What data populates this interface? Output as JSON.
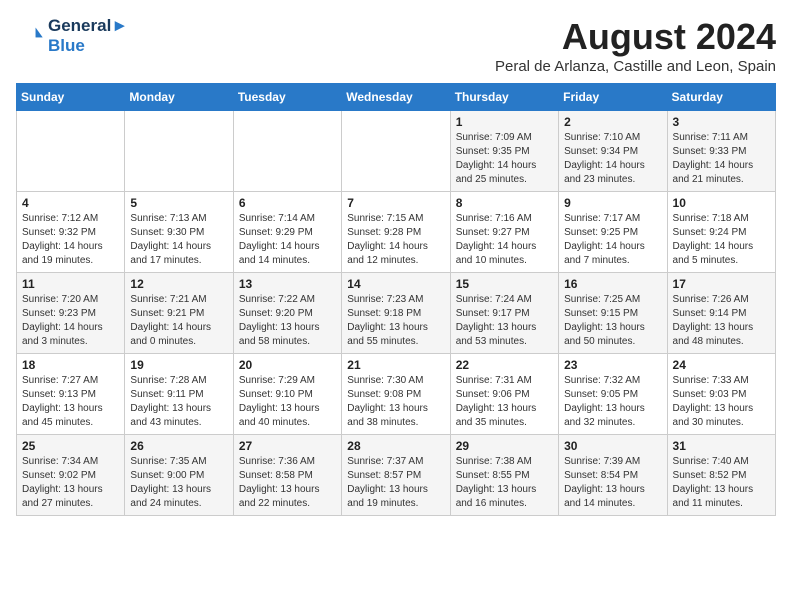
{
  "header": {
    "logo_line1": "General",
    "logo_line2": "Blue",
    "month_year": "August 2024",
    "location": "Peral de Arlanza, Castille and Leon, Spain"
  },
  "days_of_week": [
    "Sunday",
    "Monday",
    "Tuesday",
    "Wednesday",
    "Thursday",
    "Friday",
    "Saturday"
  ],
  "weeks": [
    [
      {
        "num": "",
        "info": ""
      },
      {
        "num": "",
        "info": ""
      },
      {
        "num": "",
        "info": ""
      },
      {
        "num": "",
        "info": ""
      },
      {
        "num": "1",
        "info": "Sunrise: 7:09 AM\nSunset: 9:35 PM\nDaylight: 14 hours\nand 25 minutes."
      },
      {
        "num": "2",
        "info": "Sunrise: 7:10 AM\nSunset: 9:34 PM\nDaylight: 14 hours\nand 23 minutes."
      },
      {
        "num": "3",
        "info": "Sunrise: 7:11 AM\nSunset: 9:33 PM\nDaylight: 14 hours\nand 21 minutes."
      }
    ],
    [
      {
        "num": "4",
        "info": "Sunrise: 7:12 AM\nSunset: 9:32 PM\nDaylight: 14 hours\nand 19 minutes."
      },
      {
        "num": "5",
        "info": "Sunrise: 7:13 AM\nSunset: 9:30 PM\nDaylight: 14 hours\nand 17 minutes."
      },
      {
        "num": "6",
        "info": "Sunrise: 7:14 AM\nSunset: 9:29 PM\nDaylight: 14 hours\nand 14 minutes."
      },
      {
        "num": "7",
        "info": "Sunrise: 7:15 AM\nSunset: 9:28 PM\nDaylight: 14 hours\nand 12 minutes."
      },
      {
        "num": "8",
        "info": "Sunrise: 7:16 AM\nSunset: 9:27 PM\nDaylight: 14 hours\nand 10 minutes."
      },
      {
        "num": "9",
        "info": "Sunrise: 7:17 AM\nSunset: 9:25 PM\nDaylight: 14 hours\nand 7 minutes."
      },
      {
        "num": "10",
        "info": "Sunrise: 7:18 AM\nSunset: 9:24 PM\nDaylight: 14 hours\nand 5 minutes."
      }
    ],
    [
      {
        "num": "11",
        "info": "Sunrise: 7:20 AM\nSunset: 9:23 PM\nDaylight: 14 hours\nand 3 minutes."
      },
      {
        "num": "12",
        "info": "Sunrise: 7:21 AM\nSunset: 9:21 PM\nDaylight: 14 hours\nand 0 minutes."
      },
      {
        "num": "13",
        "info": "Sunrise: 7:22 AM\nSunset: 9:20 PM\nDaylight: 13 hours\nand 58 minutes."
      },
      {
        "num": "14",
        "info": "Sunrise: 7:23 AM\nSunset: 9:18 PM\nDaylight: 13 hours\nand 55 minutes."
      },
      {
        "num": "15",
        "info": "Sunrise: 7:24 AM\nSunset: 9:17 PM\nDaylight: 13 hours\nand 53 minutes."
      },
      {
        "num": "16",
        "info": "Sunrise: 7:25 AM\nSunset: 9:15 PM\nDaylight: 13 hours\nand 50 minutes."
      },
      {
        "num": "17",
        "info": "Sunrise: 7:26 AM\nSunset: 9:14 PM\nDaylight: 13 hours\nand 48 minutes."
      }
    ],
    [
      {
        "num": "18",
        "info": "Sunrise: 7:27 AM\nSunset: 9:13 PM\nDaylight: 13 hours\nand 45 minutes."
      },
      {
        "num": "19",
        "info": "Sunrise: 7:28 AM\nSunset: 9:11 PM\nDaylight: 13 hours\nand 43 minutes."
      },
      {
        "num": "20",
        "info": "Sunrise: 7:29 AM\nSunset: 9:10 PM\nDaylight: 13 hours\nand 40 minutes."
      },
      {
        "num": "21",
        "info": "Sunrise: 7:30 AM\nSunset: 9:08 PM\nDaylight: 13 hours\nand 38 minutes."
      },
      {
        "num": "22",
        "info": "Sunrise: 7:31 AM\nSunset: 9:06 PM\nDaylight: 13 hours\nand 35 minutes."
      },
      {
        "num": "23",
        "info": "Sunrise: 7:32 AM\nSunset: 9:05 PM\nDaylight: 13 hours\nand 32 minutes."
      },
      {
        "num": "24",
        "info": "Sunrise: 7:33 AM\nSunset: 9:03 PM\nDaylight: 13 hours\nand 30 minutes."
      }
    ],
    [
      {
        "num": "25",
        "info": "Sunrise: 7:34 AM\nSunset: 9:02 PM\nDaylight: 13 hours\nand 27 minutes."
      },
      {
        "num": "26",
        "info": "Sunrise: 7:35 AM\nSunset: 9:00 PM\nDaylight: 13 hours\nand 24 minutes."
      },
      {
        "num": "27",
        "info": "Sunrise: 7:36 AM\nSunset: 8:58 PM\nDaylight: 13 hours\nand 22 minutes."
      },
      {
        "num": "28",
        "info": "Sunrise: 7:37 AM\nSunset: 8:57 PM\nDaylight: 13 hours\nand 19 minutes."
      },
      {
        "num": "29",
        "info": "Sunrise: 7:38 AM\nSunset: 8:55 PM\nDaylight: 13 hours\nand 16 minutes."
      },
      {
        "num": "30",
        "info": "Sunrise: 7:39 AM\nSunset: 8:54 PM\nDaylight: 13 hours\nand 14 minutes."
      },
      {
        "num": "31",
        "info": "Sunrise: 7:40 AM\nSunset: 8:52 PM\nDaylight: 13 hours\nand 11 minutes."
      }
    ]
  ]
}
